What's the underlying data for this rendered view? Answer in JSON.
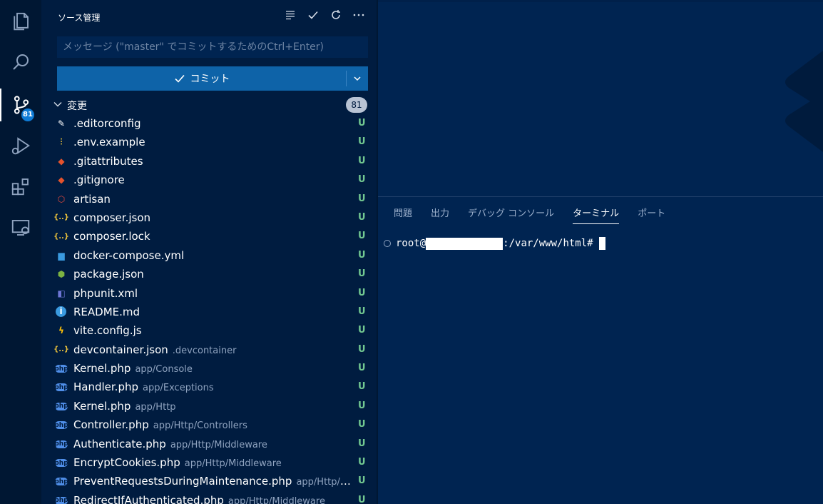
{
  "colors": {
    "background": "#002451",
    "sidebar": "#001c40",
    "activity_bar": "#001733",
    "commit_button": "#0e63a8",
    "untracked_status": "#73c991",
    "badge": "#0e7bd6"
  },
  "activity_bar": {
    "items": [
      {
        "icon": "files-icon"
      },
      {
        "icon": "search-icon"
      },
      {
        "icon": "source-control-icon",
        "badge": "81"
      },
      {
        "icon": "run-debug-icon"
      },
      {
        "icon": "extensions-icon"
      },
      {
        "icon": "remote-explorer-icon"
      }
    ]
  },
  "sidebar": {
    "title": "ソース管理",
    "actions": [
      "view-as-list-icon",
      "commit-check-icon",
      "refresh-icon",
      "more-actions-icon"
    ],
    "message_placeholder": "メッセージ (\"master\" でコミットするためのCtrl+Enter)",
    "message_value": "",
    "commit_label": "コミット",
    "changes_label": "変更",
    "changes_count": "81",
    "files": [
      {
        "name": ".editorconfig",
        "path": "",
        "status": "U",
        "icon": "editorconfig-icon",
        "glyph": "✎",
        "color": "#ffffff"
      },
      {
        "name": ".env.example",
        "path": "",
        "status": "U",
        "icon": "env-settings-icon",
        "glyph": "⫶",
        "color": "#e8c03c"
      },
      {
        "name": ".gitattributes",
        "path": "",
        "status": "U",
        "icon": "git-icon",
        "glyph": "◆",
        "color": "#e5532d"
      },
      {
        "name": ".gitignore",
        "path": "",
        "status": "U",
        "icon": "git-icon",
        "glyph": "◆",
        "color": "#e5532d"
      },
      {
        "name": "artisan",
        "path": "",
        "status": "U",
        "icon": "laravel-icon",
        "glyph": "⬡",
        "color": "#e3493d"
      },
      {
        "name": "composer.json",
        "path": "",
        "status": "U",
        "icon": "json-icon",
        "glyph": "{..}",
        "color": "#e8c03c"
      },
      {
        "name": "composer.lock",
        "path": "",
        "status": "U",
        "icon": "json-icon",
        "glyph": "{..}",
        "color": "#e8c03c"
      },
      {
        "name": "docker-compose.yml",
        "path": "",
        "status": "U",
        "icon": "docker-icon",
        "glyph": "▆",
        "color": "#3a9ae0"
      },
      {
        "name": "package.json",
        "path": "",
        "status": "U",
        "icon": "nodejs-icon",
        "glyph": "⬢",
        "color": "#7cb342"
      },
      {
        "name": "phpunit.xml",
        "path": "",
        "status": "U",
        "icon": "phpunit-icon",
        "glyph": "◧",
        "color": "#6e76d6"
      },
      {
        "name": "README.md",
        "path": "",
        "status": "U",
        "icon": "info-icon",
        "glyph": "i",
        "color": "#3a9ae0"
      },
      {
        "name": "vite.config.js",
        "path": "",
        "status": "U",
        "icon": "vite-icon",
        "glyph": "ϟ",
        "color": "#ffc107"
      },
      {
        "name": "devcontainer.json",
        "path": ".devcontainer",
        "status": "U",
        "icon": "json-icon",
        "glyph": "{..}",
        "color": "#e8c03c"
      },
      {
        "name": "Kernel.php",
        "path": "app/Console",
        "status": "U",
        "icon": "php-icon",
        "glyph": "php",
        "color": "#4f8ee8"
      },
      {
        "name": "Handler.php",
        "path": "app/Exceptions",
        "status": "U",
        "icon": "php-icon",
        "glyph": "php",
        "color": "#4f8ee8"
      },
      {
        "name": "Kernel.php",
        "path": "app/Http",
        "status": "U",
        "icon": "php-icon",
        "glyph": "php",
        "color": "#4f8ee8"
      },
      {
        "name": "Controller.php",
        "path": "app/Http/Controllers",
        "status": "U",
        "icon": "php-icon",
        "glyph": "php",
        "color": "#4f8ee8"
      },
      {
        "name": "Authenticate.php",
        "path": "app/Http/Middleware",
        "status": "U",
        "icon": "php-icon",
        "glyph": "php",
        "color": "#4f8ee8"
      },
      {
        "name": "EncryptCookies.php",
        "path": "app/Http/Middleware",
        "status": "U",
        "icon": "php-icon",
        "glyph": "php",
        "color": "#4f8ee8"
      },
      {
        "name": "PreventRequestsDuringMaintenance.php",
        "path": "app/Http/Mid...",
        "status": "U",
        "icon": "php-icon",
        "glyph": "php",
        "color": "#4f8ee8"
      },
      {
        "name": "RedirectIfAuthenticated.php",
        "path": "app/Http/Middleware",
        "status": "U",
        "icon": "php-icon",
        "glyph": "php",
        "color": "#4f8ee8"
      }
    ]
  },
  "panel": {
    "tabs": [
      {
        "label": "問題",
        "active": false
      },
      {
        "label": "出力",
        "active": false
      },
      {
        "label": "デバッグ コンソール",
        "active": false
      },
      {
        "label": "ターミナル",
        "active": true
      },
      {
        "label": "ポート",
        "active": false
      }
    ],
    "terminal": {
      "prompt_user": "root@",
      "prompt_path": ":/var/www/html#"
    }
  }
}
